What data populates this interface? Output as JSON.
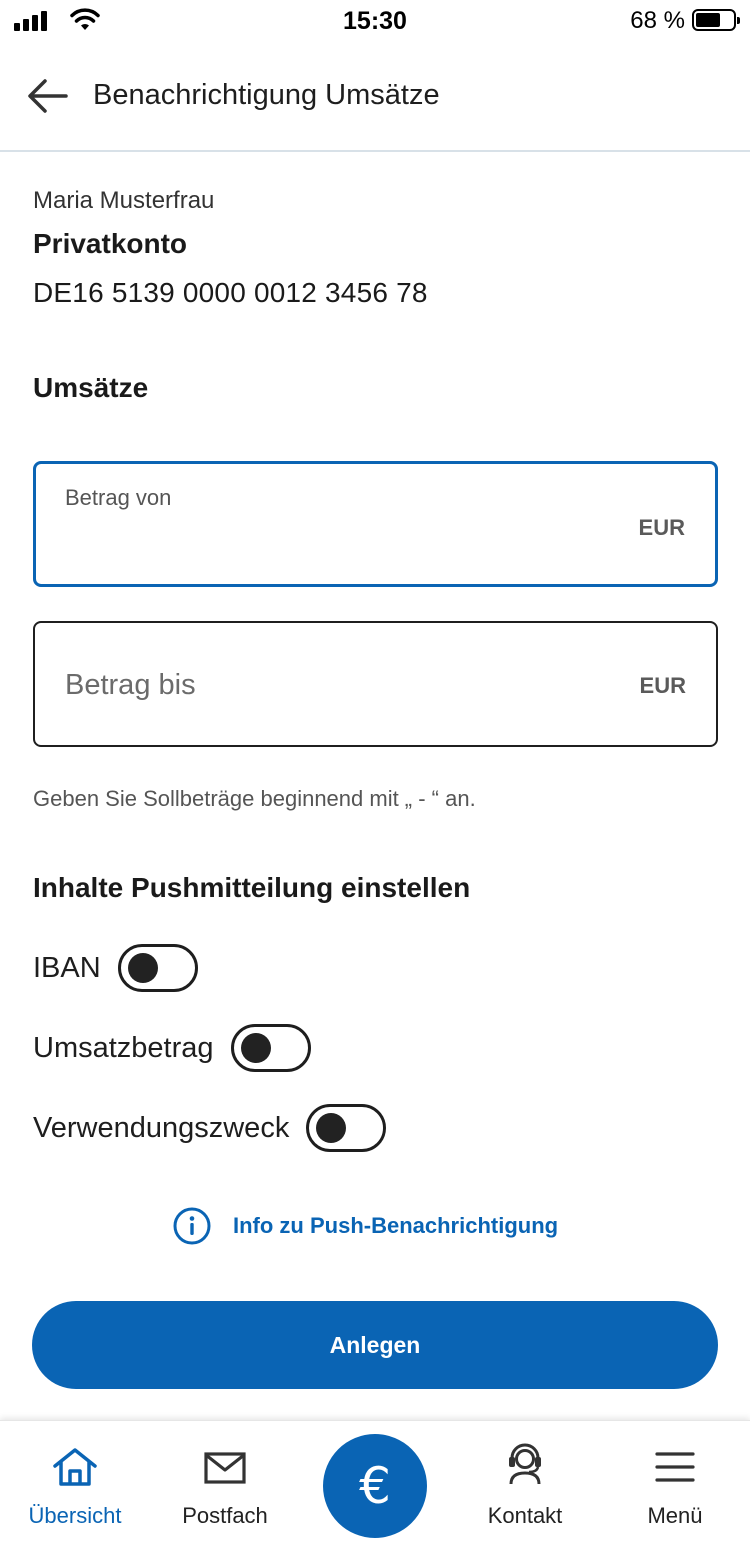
{
  "status_bar": {
    "time": "15:30",
    "battery_text": "68 %",
    "battery_level": 0.68
  },
  "header": {
    "title": "Benachrichtigung Umsätze",
    "back_icon": "arrow-left-icon"
  },
  "account": {
    "owner": "Maria Musterfrau",
    "type": "Privatkonto",
    "iban": "DE16 5139 0000 0012 3456 78"
  },
  "umsaetze": {
    "heading": "Umsätze",
    "amount_from": {
      "label": "Betrag von",
      "currency": "EUR",
      "value": ""
    },
    "amount_to": {
      "label": "Betrag bis",
      "currency": "EUR",
      "value": ""
    },
    "hint": "Geben Sie Sollbeträge beginnend mit „ - “ an."
  },
  "push": {
    "heading": "Inhalte Pushmitteilung einstellen",
    "toggles": [
      {
        "label": "IBAN",
        "on": false
      },
      {
        "label": "Umsatzbetrag",
        "on": false
      },
      {
        "label": "Verwendungszweck",
        "on": false
      }
    ],
    "info_link": "Info zu Push-Benachrichtigung",
    "info_icon": "info-circle-icon"
  },
  "actions": {
    "submit": "Anlegen"
  },
  "bottom_nav": {
    "items": [
      {
        "label": "Übersicht",
        "icon": "home-icon",
        "active": true
      },
      {
        "label": "Postfach",
        "icon": "mail-icon",
        "active": false
      },
      {
        "label": "",
        "icon": "euro-icon",
        "center_symbol": "€"
      },
      {
        "label": "Kontakt",
        "icon": "headset-icon",
        "active": false
      },
      {
        "label": "Menü",
        "icon": "hamburger-menu-icon",
        "active": false
      }
    ]
  },
  "colors": {
    "accent": "#0a64b4",
    "text": "#1e1e1e",
    "muted": "#555555"
  }
}
